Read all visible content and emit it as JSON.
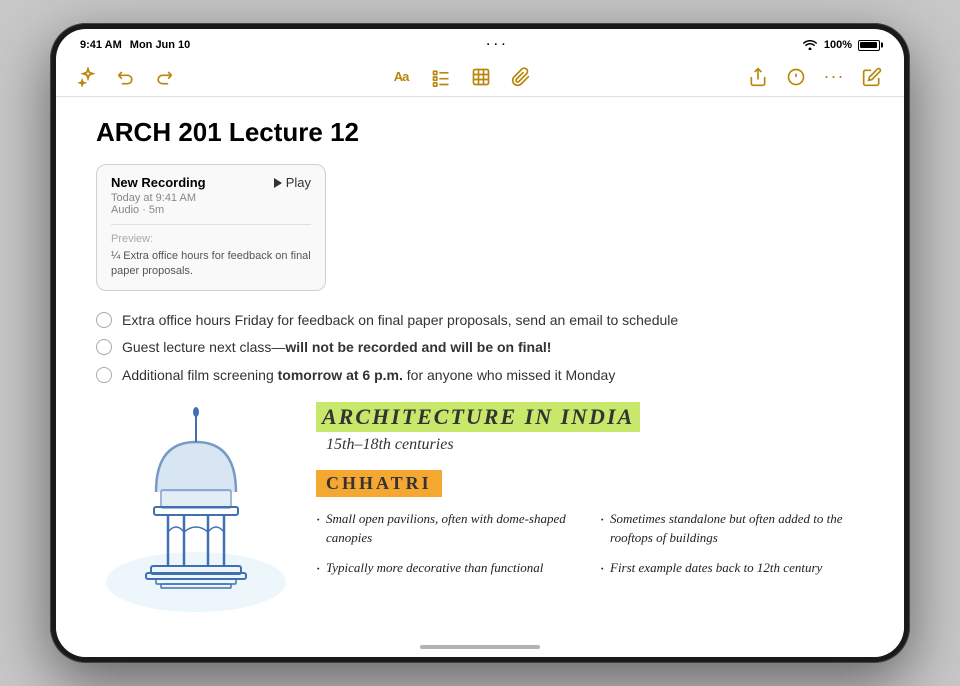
{
  "device": {
    "model": "iPad Pro"
  },
  "statusBar": {
    "time": "9:41 AM",
    "date": "Mon Jun 10",
    "wifi": "WiFi",
    "battery": "100%",
    "dots": [
      "·",
      "·",
      "·"
    ]
  },
  "toolbar": {
    "icons": {
      "sparkle": "✦",
      "undo": "↩",
      "redo": "↪",
      "text_format": "Aa",
      "checklist": "☑",
      "table": "⊞",
      "attachment": "⊕",
      "share": "↑",
      "markup": "✏",
      "more": "···",
      "compose": "✎"
    }
  },
  "note": {
    "title": "ARCH 201 Lecture 12",
    "recording": {
      "label": "New Recording",
      "date": "Today at 9:41 AM",
      "meta": "Audio · 5m",
      "play_label": "Play",
      "preview_label": "Preview:",
      "preview_text": "¼ Extra office hours for feedback on final paper proposals."
    },
    "checklist": [
      {
        "text": "Extra office hours Friday for feedback on final paper proposals, send an email to schedule",
        "checked": false
      },
      {
        "text": "Guest lecture next class—will not be recorded and will be on final!",
        "checked": false,
        "bold_part": "will not be recorded and will be on final!"
      },
      {
        "text": "Additional film screening tomorrow at 6 p.m. for anyone who missed it Monday",
        "checked": false,
        "bold_part": "tomorrow at 6 p.m."
      }
    ],
    "architecture_section": {
      "title": "ARCHITECTURE IN INDIA",
      "subtitle": "15th–18th centuries",
      "chhatri_label": "CHHATRI",
      "points": [
        {
          "text": "Small open pavilions, often with dome-shaped canopies"
        },
        {
          "text": "Sometimes standalone but often added to the rooftops of buildings"
        },
        {
          "text": "Typically more decorative than functional"
        },
        {
          "text": "First example dates back to 12th century"
        }
      ]
    }
  }
}
